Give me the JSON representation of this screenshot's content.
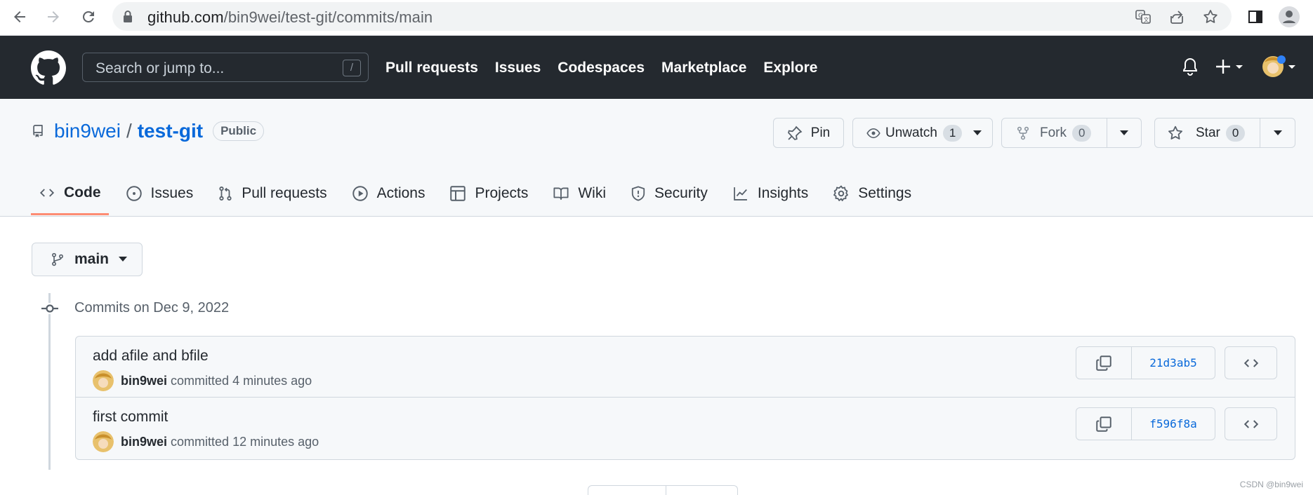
{
  "browser": {
    "url_host": "github.com",
    "url_path": "/bin9wei/test-git/commits/main"
  },
  "header": {
    "search_placeholder": "Search or jump to...",
    "search_shortcut": "/",
    "nav": [
      "Pull requests",
      "Issues",
      "Codespaces",
      "Marketplace",
      "Explore"
    ]
  },
  "repo": {
    "owner": "bin9wei",
    "separator": "/",
    "name": "test-git",
    "visibility": "Public",
    "pin_label": "Pin",
    "unwatch_label": "Unwatch",
    "watch_count": "1",
    "fork_label": "Fork",
    "fork_count": "0",
    "star_label": "Star",
    "star_count": "0"
  },
  "tabs": [
    {
      "label": "Code",
      "icon": "code-icon",
      "active": true
    },
    {
      "label": "Issues",
      "icon": "issue-icon"
    },
    {
      "label": "Pull requests",
      "icon": "pull-request-icon"
    },
    {
      "label": "Actions",
      "icon": "play-icon"
    },
    {
      "label": "Projects",
      "icon": "table-icon"
    },
    {
      "label": "Wiki",
      "icon": "book-icon"
    },
    {
      "label": "Security",
      "icon": "shield-icon"
    },
    {
      "label": "Insights",
      "icon": "graph-icon"
    },
    {
      "label": "Settings",
      "icon": "gear-icon"
    }
  ],
  "branch": {
    "name": "main"
  },
  "commit_group": {
    "date_heading": "Commits on Dec 9, 2022"
  },
  "commits": [
    {
      "message": "add afile and bfile",
      "author": "bin9wei",
      "action": "committed",
      "time": "4 minutes ago",
      "sha": "21d3ab5"
    },
    {
      "message": "first commit",
      "author": "bin9wei",
      "action": "committed",
      "time": "12 minutes ago",
      "sha": "f596f8a"
    }
  ],
  "watermark": "CSDN @bin9wei",
  "colors": {
    "accent": "#0969da",
    "header_bg": "#24292f",
    "tab_underline": "#fd8c73"
  }
}
